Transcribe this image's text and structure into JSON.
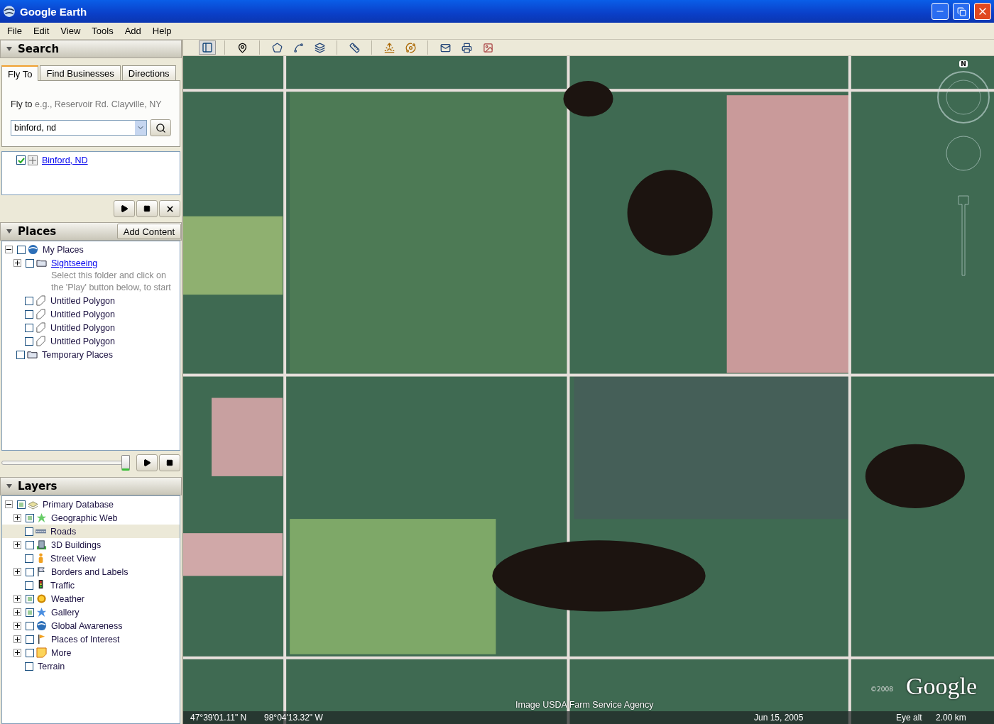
{
  "window": {
    "title": "Google Earth"
  },
  "menu": [
    "File",
    "Edit",
    "View",
    "Tools",
    "Add",
    "Help"
  ],
  "search": {
    "title": "Search",
    "expanded": true,
    "tabs": [
      {
        "label": "Fly To",
        "selected": true
      },
      {
        "label": "Find Businesses",
        "selected": false
      },
      {
        "label": "Directions",
        "selected": false
      }
    ],
    "fly_to_label": "Fly to",
    "hint": "e.g., Reservoir Rd. Clayville, NY",
    "value": "binford, nd",
    "results": [
      {
        "label": "Binford, ND",
        "checked": true
      }
    ]
  },
  "places": {
    "title": "Places",
    "expanded": true,
    "add_content": "Add Content",
    "tree": [
      {
        "label": "My Places",
        "kind": "globe",
        "link": false,
        "checked": false,
        "expandable": true,
        "expanded": true,
        "children": [
          {
            "label": "Sightseeing",
            "kind": "folder",
            "link": true,
            "checked": false,
            "expandable": true,
            "expanded": false,
            "description": "Select this folder and click on the 'Play' button below, to start"
          },
          {
            "label": "Untitled Polygon",
            "kind": "polygon",
            "link": false,
            "checked": false,
            "expandable": false
          },
          {
            "label": "Untitled Polygon",
            "kind": "polygon",
            "link": false,
            "checked": false,
            "expandable": false
          },
          {
            "label": "Untitled Polygon",
            "kind": "polygon",
            "link": false,
            "checked": false,
            "expandable": false
          },
          {
            "label": "Untitled Polygon",
            "kind": "polygon",
            "link": false,
            "checked": false,
            "expandable": false
          }
        ]
      },
      {
        "label": "Temporary Places",
        "kind": "folder",
        "link": false,
        "checked": false,
        "expandable": false
      }
    ],
    "tour_speed": {
      "level": 0.97
    }
  },
  "layers": {
    "title": "Layers",
    "expanded": true,
    "tree": [
      {
        "label": "Primary Database",
        "kind": "database",
        "checked": true,
        "selected": false,
        "expandable": true,
        "expanded": true,
        "children": [
          {
            "label": "Geographic Web",
            "kind": "star",
            "checked": true,
            "selected": false,
            "expandable": true,
            "expanded": false
          },
          {
            "label": "Roads",
            "kind": "road",
            "checked": false,
            "selected": true,
            "expandable": false
          },
          {
            "label": "3D Buildings",
            "kind": "building",
            "checked": false,
            "selected": false,
            "expandable": true,
            "expanded": false
          },
          {
            "label": "Street View",
            "kind": "person",
            "checked": false,
            "selected": false,
            "expandable": false
          },
          {
            "label": "Borders and Labels",
            "kind": "flag",
            "checked": false,
            "selected": false,
            "expandable": true,
            "expanded": false
          },
          {
            "label": "Traffic",
            "kind": "traffic",
            "checked": false,
            "selected": false,
            "expandable": false
          },
          {
            "label": "Weather",
            "kind": "sun",
            "checked": true,
            "selected": false,
            "expandable": true,
            "expanded": false
          },
          {
            "label": "Gallery",
            "kind": "bluestar",
            "checked": true,
            "selected": false,
            "expandable": true,
            "expanded": false
          },
          {
            "label": "Global Awareness",
            "kind": "globe",
            "checked": false,
            "selected": false,
            "expandable": true,
            "expanded": false
          },
          {
            "label": "Places of Interest",
            "kind": "pennant",
            "checked": false,
            "selected": false,
            "expandable": true,
            "expanded": false
          },
          {
            "label": "More",
            "kind": "note",
            "checked": false,
            "selected": false,
            "expandable": true,
            "expanded": false
          },
          {
            "label": "Terrain",
            "kind": "none",
            "checked": false,
            "selected": false,
            "expandable": false
          }
        ]
      }
    ]
  },
  "map": {
    "compass_label": "N",
    "attribution": "Image USDA Farm Service Agency",
    "copyright": "©2008",
    "logo": "Google",
    "status": {
      "latitude": "47°39'01.11\" N",
      "longitude": "98°04'13.32\" W",
      "date": "Jun 15, 2005",
      "eye_alt_label": "Eye alt",
      "eye_alt": "2.00 km"
    }
  }
}
